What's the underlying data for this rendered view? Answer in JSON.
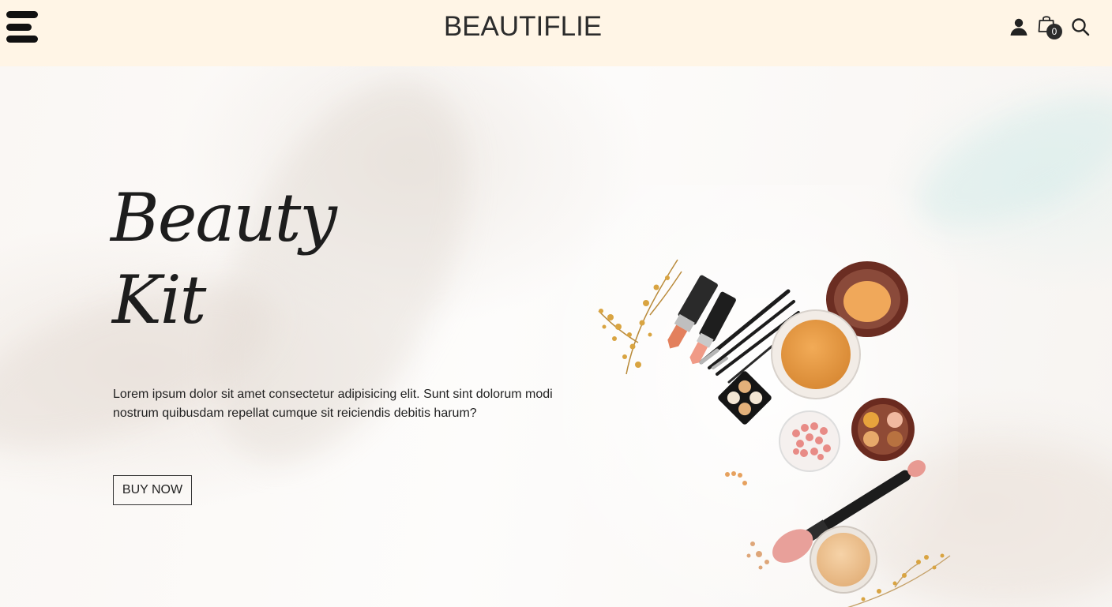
{
  "header": {
    "brand": "BEAUTIFLIE",
    "cart_count": "0",
    "icons": [
      "menu-icon",
      "user-icon",
      "shopping-bag-icon",
      "search-icon"
    ]
  },
  "hero": {
    "title_line1": "Beauty",
    "title_line2": "Kit",
    "description": "Lorem ipsum dolor sit amet consectetur adipisicing elit. Sunt sint dolorum modi nostrum quibusdam repellat cumque sit reiciendis debitis harum?",
    "button_label": "BUY NOW"
  },
  "colors": {
    "header_bg": "#fff5e6",
    "text": "#222222",
    "accent_orange": "#e39a45",
    "accent_pink": "#e98f8a"
  }
}
